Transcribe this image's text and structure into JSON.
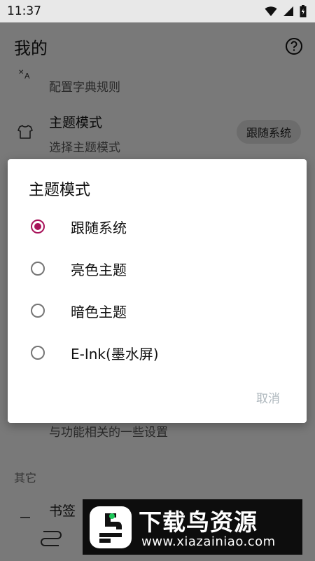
{
  "status_bar": {
    "time": "11:37",
    "icons": [
      "wifi-icon",
      "signal-icon",
      "battery-icon"
    ]
  },
  "appbar": {
    "title": "我的",
    "help_icon": "help-circle-icon"
  },
  "background": {
    "rows": [
      {
        "title": "",
        "summary": "配置字典规则",
        "icon": "translate-icon"
      },
      {
        "title": "主题模式",
        "summary": "选择主题模式",
        "icon": "shirt-icon",
        "chip": "跟随系统"
      },
      {
        "title": "",
        "summary": "与功能相关的一些设置",
        "icon": ""
      },
      {
        "title": "书签",
        "summary": "",
        "icon": "bookmark-icon"
      }
    ],
    "section_header": "其它"
  },
  "dialog": {
    "title": "主题模式",
    "options": [
      {
        "label": "跟随系统",
        "checked": true
      },
      {
        "label": "亮色主题",
        "checked": false
      },
      {
        "label": "暗色主题",
        "checked": false
      },
      {
        "label": "E-Ink(墨水屏)",
        "checked": false
      }
    ],
    "cancel_label": "取消"
  },
  "watermark": {
    "name": "下载鸟资源",
    "url": "www.xiazainiao.com"
  },
  "colors": {
    "accent": "#a8135a",
    "cancel": "#aeb7bd",
    "scrim": "rgba(0,0,0,0.5)"
  }
}
